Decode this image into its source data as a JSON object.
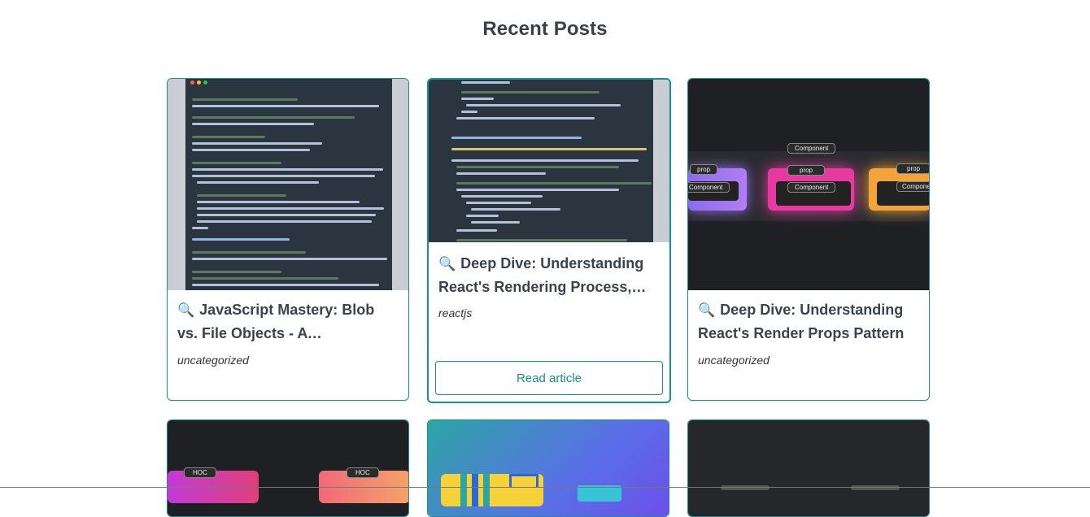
{
  "page": {
    "title": "Recent Posts"
  },
  "posts": [
    {
      "emoji": "🔍",
      "title": "JavaScript Mastery: Blob vs. File Objects - A Comprehensive Guide",
      "category": "uncategorized",
      "thumbnail": "code-screenshot"
    },
    {
      "emoji": "🔍",
      "title": "Deep Dive: Understanding React's Rendering Process, State and Hooks",
      "category": "reactjs",
      "thumbnail": "code-screenshot",
      "button_label": "Read article"
    },
    {
      "emoji": "🔍",
      "title": "Deep Dive: Understanding React's Render Props Pattern",
      "category": "uncategorized",
      "thumbnail": "component-diagram",
      "labels": [
        "Component",
        "prop",
        "prop",
        "prop",
        "Component",
        "Component",
        "Componen"
      ]
    },
    {
      "thumbnail": "hoc-diagram",
      "labels": [
        "HOC",
        "HOC"
      ]
    },
    {
      "thumbnail": "gradient-illustration"
    },
    {
      "thumbnail": "dark-diagram"
    }
  ],
  "colors": {
    "accent": "#1b8f8f",
    "title_text": "#3b4250"
  }
}
